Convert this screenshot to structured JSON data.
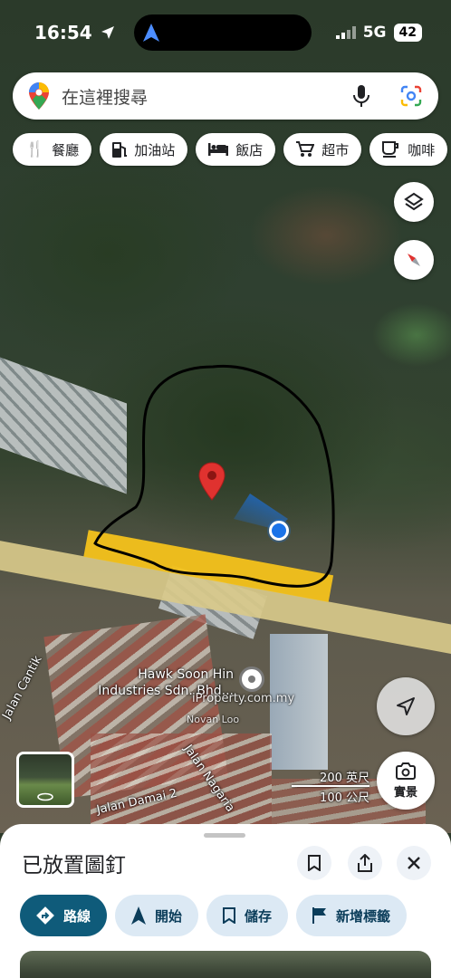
{
  "status_bar": {
    "time": "16:54",
    "network": "5G",
    "battery": "42"
  },
  "search": {
    "placeholder": "在這裡搜尋"
  },
  "chips": [
    {
      "label": "餐廳",
      "icon": "fork-knife-icon"
    },
    {
      "label": "加油站",
      "icon": "gas-pump-icon"
    },
    {
      "label": "飯店",
      "icon": "bed-icon"
    },
    {
      "label": "超市",
      "icon": "cart-icon"
    },
    {
      "label": "咖啡",
      "icon": "coffee-icon"
    }
  ],
  "map": {
    "place_label": "Hawk Soon Hin Industries Sdn. Bhd...",
    "watermark": "iProperty.com.my",
    "watermark_author": "Novan Loo",
    "streets": [
      "Jalan Cantik",
      "Jalan Nagaria",
      "Jalan Damai 2"
    ],
    "scale_imperial": "200 英尺",
    "scale_metric": "100 公尺",
    "street_view_label": "實景"
  },
  "sheet": {
    "title": "已放置圖釘",
    "actions": [
      {
        "label": "路線",
        "icon": "directions-icon"
      },
      {
        "label": "開始",
        "icon": "navigation-arrow-icon"
      },
      {
        "label": "儲存",
        "icon": "bookmark-icon"
      },
      {
        "label": "新增標籤",
        "icon": "flag-icon"
      }
    ]
  },
  "colors": {
    "primary_action": "#0f5b7a",
    "action_chip": "#dce9f4",
    "pin": "#e0322f",
    "highlight_road": "#f4c21b",
    "location_dot": "#1a73e8"
  }
}
